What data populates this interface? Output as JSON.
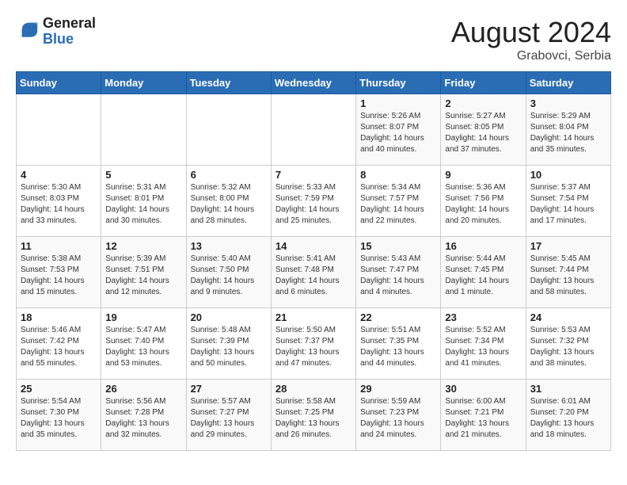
{
  "header": {
    "logo_line1": "General",
    "logo_line2": "Blue",
    "month_year": "August 2024",
    "location": "Grabovci, Serbia"
  },
  "weekdays": [
    "Sunday",
    "Monday",
    "Tuesday",
    "Wednesday",
    "Thursday",
    "Friday",
    "Saturday"
  ],
  "weeks": [
    [
      {
        "day": "",
        "info": ""
      },
      {
        "day": "",
        "info": ""
      },
      {
        "day": "",
        "info": ""
      },
      {
        "day": "",
        "info": ""
      },
      {
        "day": "1",
        "info": "Sunrise: 5:26 AM\nSunset: 8:07 PM\nDaylight: 14 hours and 40 minutes."
      },
      {
        "day": "2",
        "info": "Sunrise: 5:27 AM\nSunset: 8:05 PM\nDaylight: 14 hours and 37 minutes."
      },
      {
        "day": "3",
        "info": "Sunrise: 5:29 AM\nSunset: 8:04 PM\nDaylight: 14 hours and 35 minutes."
      }
    ],
    [
      {
        "day": "4",
        "info": "Sunrise: 5:30 AM\nSunset: 8:03 PM\nDaylight: 14 hours and 33 minutes."
      },
      {
        "day": "5",
        "info": "Sunrise: 5:31 AM\nSunset: 8:01 PM\nDaylight: 14 hours and 30 minutes."
      },
      {
        "day": "6",
        "info": "Sunrise: 5:32 AM\nSunset: 8:00 PM\nDaylight: 14 hours and 28 minutes."
      },
      {
        "day": "7",
        "info": "Sunrise: 5:33 AM\nSunset: 7:59 PM\nDaylight: 14 hours and 25 minutes."
      },
      {
        "day": "8",
        "info": "Sunrise: 5:34 AM\nSunset: 7:57 PM\nDaylight: 14 hours and 22 minutes."
      },
      {
        "day": "9",
        "info": "Sunrise: 5:36 AM\nSunset: 7:56 PM\nDaylight: 14 hours and 20 minutes."
      },
      {
        "day": "10",
        "info": "Sunrise: 5:37 AM\nSunset: 7:54 PM\nDaylight: 14 hours and 17 minutes."
      }
    ],
    [
      {
        "day": "11",
        "info": "Sunrise: 5:38 AM\nSunset: 7:53 PM\nDaylight: 14 hours and 15 minutes."
      },
      {
        "day": "12",
        "info": "Sunrise: 5:39 AM\nSunset: 7:51 PM\nDaylight: 14 hours and 12 minutes."
      },
      {
        "day": "13",
        "info": "Sunrise: 5:40 AM\nSunset: 7:50 PM\nDaylight: 14 hours and 9 minutes."
      },
      {
        "day": "14",
        "info": "Sunrise: 5:41 AM\nSunset: 7:48 PM\nDaylight: 14 hours and 6 minutes."
      },
      {
        "day": "15",
        "info": "Sunrise: 5:43 AM\nSunset: 7:47 PM\nDaylight: 14 hours and 4 minutes."
      },
      {
        "day": "16",
        "info": "Sunrise: 5:44 AM\nSunset: 7:45 PM\nDaylight: 14 hours and 1 minute."
      },
      {
        "day": "17",
        "info": "Sunrise: 5:45 AM\nSunset: 7:44 PM\nDaylight: 13 hours and 58 minutes."
      }
    ],
    [
      {
        "day": "18",
        "info": "Sunrise: 5:46 AM\nSunset: 7:42 PM\nDaylight: 13 hours and 55 minutes."
      },
      {
        "day": "19",
        "info": "Sunrise: 5:47 AM\nSunset: 7:40 PM\nDaylight: 13 hours and 53 minutes."
      },
      {
        "day": "20",
        "info": "Sunrise: 5:48 AM\nSunset: 7:39 PM\nDaylight: 13 hours and 50 minutes."
      },
      {
        "day": "21",
        "info": "Sunrise: 5:50 AM\nSunset: 7:37 PM\nDaylight: 13 hours and 47 minutes."
      },
      {
        "day": "22",
        "info": "Sunrise: 5:51 AM\nSunset: 7:35 PM\nDaylight: 13 hours and 44 minutes."
      },
      {
        "day": "23",
        "info": "Sunrise: 5:52 AM\nSunset: 7:34 PM\nDaylight: 13 hours and 41 minutes."
      },
      {
        "day": "24",
        "info": "Sunrise: 5:53 AM\nSunset: 7:32 PM\nDaylight: 13 hours and 38 minutes."
      }
    ],
    [
      {
        "day": "25",
        "info": "Sunrise: 5:54 AM\nSunset: 7:30 PM\nDaylight: 13 hours and 35 minutes."
      },
      {
        "day": "26",
        "info": "Sunrise: 5:56 AM\nSunset: 7:28 PM\nDaylight: 13 hours and 32 minutes."
      },
      {
        "day": "27",
        "info": "Sunrise: 5:57 AM\nSunset: 7:27 PM\nDaylight: 13 hours and 29 minutes."
      },
      {
        "day": "28",
        "info": "Sunrise: 5:58 AM\nSunset: 7:25 PM\nDaylight: 13 hours and 26 minutes."
      },
      {
        "day": "29",
        "info": "Sunrise: 5:59 AM\nSunset: 7:23 PM\nDaylight: 13 hours and 24 minutes."
      },
      {
        "day": "30",
        "info": "Sunrise: 6:00 AM\nSunset: 7:21 PM\nDaylight: 13 hours and 21 minutes."
      },
      {
        "day": "31",
        "info": "Sunrise: 6:01 AM\nSunset: 7:20 PM\nDaylight: 13 hours and 18 minutes."
      }
    ]
  ]
}
